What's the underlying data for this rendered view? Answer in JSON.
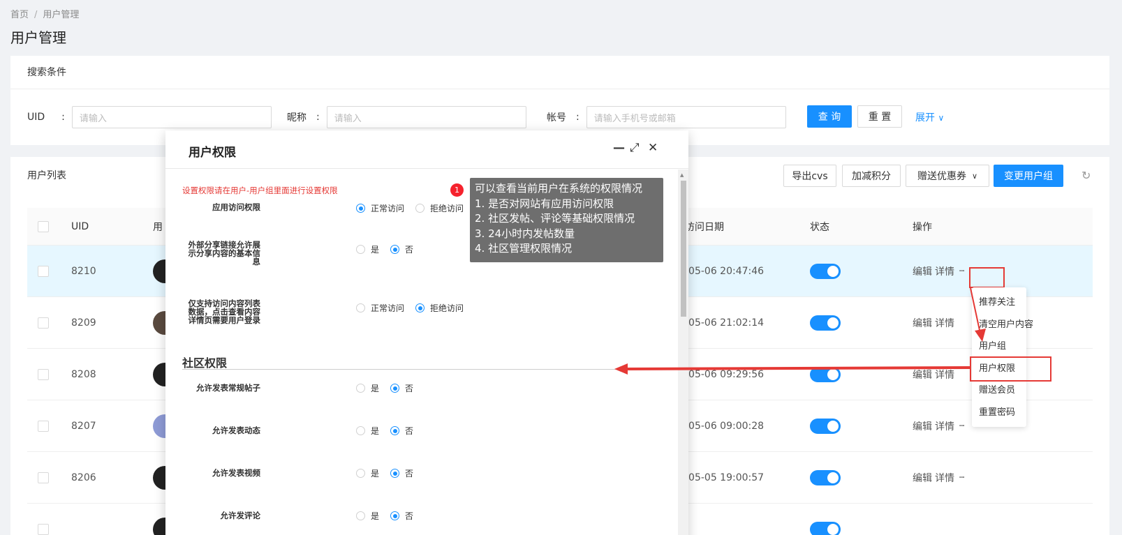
{
  "breadcrumb": {
    "home": "首页",
    "separator": "/",
    "current": "用户管理"
  },
  "page_title": "用户管理",
  "search": {
    "title": "搜索条件",
    "fields": [
      {
        "label": "UID",
        "colon": ":",
        "placeholder": "请输入"
      },
      {
        "label": "昵称",
        "colon": ":",
        "placeholder": "请输入"
      },
      {
        "label": "帐号",
        "colon": ":",
        "placeholder": "请输入手机号或邮箱"
      }
    ],
    "query_btn": "查 询",
    "reset_btn": "重 置",
    "expand": "展开",
    "expand_icon": "∨"
  },
  "list": {
    "title": "用户列表",
    "buttons": {
      "export": "导出cvs",
      "points": "加减积分",
      "coupon": "赠送优惠券",
      "coupon_icon": "∨",
      "change_group": "变更用户组"
    },
    "refresh_icon": "↻",
    "columns": {
      "uid": "UID",
      "user_partial": "用",
      "date_partial": "访问日期",
      "status": "状态",
      "ops": "操作"
    },
    "rows": [
      {
        "uid": "8210",
        "date": "-05-06 20:47:46",
        "edit": "编辑",
        "detail": "详情",
        "more": "···",
        "avatar": "dark"
      },
      {
        "uid": "8209",
        "date": "-05-06 21:02:14",
        "edit": "编辑",
        "detail": "详情",
        "more": "···",
        "avatar": "photo"
      },
      {
        "uid": "8208",
        "date": "-05-06 09:29:56",
        "edit": "编辑",
        "detail": "详情",
        "more": "···",
        "avatar": "dark"
      },
      {
        "uid": "8207",
        "date": "-05-06 09:00:28",
        "edit": "编辑",
        "detail": "详情",
        "more": "···",
        "avatar": "blue"
      },
      {
        "uid": "8206",
        "date": "-05-05 19:00:57",
        "edit": "编辑",
        "detail": "详情",
        "more": "···",
        "avatar": "dark"
      }
    ]
  },
  "dropdown": {
    "items": [
      "推荐关注",
      "清空用户内容",
      "用户组",
      "用户权限",
      "赠送会员",
      "重置密码"
    ]
  },
  "modal": {
    "title": "用户权限",
    "minimize_icon": "—",
    "maximize_icon": "⤢",
    "close_icon": "✕",
    "notice": "设置权限请在用户-用户组里面进行设置权限",
    "perms": [
      {
        "label": "应用访问权限",
        "options": [
          "正常访问",
          "拒绝访问"
        ],
        "selected": 0
      },
      {
        "label": "外部分享链接允许展示分享内容的基本信息",
        "options": [
          "是",
          "否"
        ],
        "selected": 1
      },
      {
        "label": "仅支持访问内容列表数据，点击查看内容详情页需要用户登录",
        "options": [
          "正常访问",
          "拒绝访问"
        ],
        "selected": 1
      }
    ],
    "section": "社区权限",
    "community_perms": [
      {
        "label": "允许发表常规帖子",
        "options": [
          "是",
          "否"
        ],
        "selected": 1
      },
      {
        "label": "允许发表动态",
        "options": [
          "是",
          "否"
        ],
        "selected": 1
      },
      {
        "label": "允许发表视频",
        "options": [
          "是",
          "否"
        ],
        "selected": 1
      },
      {
        "label": "允许发评论",
        "options": [
          "是",
          "否"
        ],
        "selected": 1
      }
    ]
  },
  "tooltip": {
    "badge": "1",
    "lines": [
      "可以查看当前用户在系统的权限情况",
      "1. 是否对网站有应用访问权限",
      "2. 社区发帖、评论等基础权限情况",
      "3. 24小时内发帖数量",
      "4. 社区管理权限情况"
    ]
  },
  "colors": {
    "primary": "#1890ff",
    "annotation": "#e53935",
    "tooltip_bg": "#6e6e6e"
  }
}
